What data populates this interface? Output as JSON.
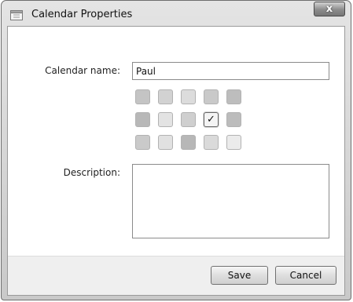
{
  "window": {
    "title": "Calendar Properties",
    "close_label": "x",
    "title_icon": "calendar-icon"
  },
  "form": {
    "name_label": "Calendar name:",
    "name_value": "Paul",
    "description_label": "Description:",
    "description_value": ""
  },
  "color_swatches": {
    "rows": [
      [
        "#c4c4c4",
        "#d2d2d2",
        "#dcdcdc",
        "#c9c9c9",
        "#bdbdbd"
      ],
      [
        "#b8b8b8",
        "#e3e3e3",
        "#cfcfcf",
        "#f4f4f4",
        "#bcbcbc"
      ],
      [
        "#cacaca",
        "#e1e1e1",
        "#b7b7b7",
        "#dadada",
        "#ebebeb"
      ]
    ],
    "selected_row": 1,
    "selected_col": 3,
    "check_glyph": "✓"
  },
  "buttons": {
    "save_label": "Save",
    "cancel_label": "Cancel"
  }
}
